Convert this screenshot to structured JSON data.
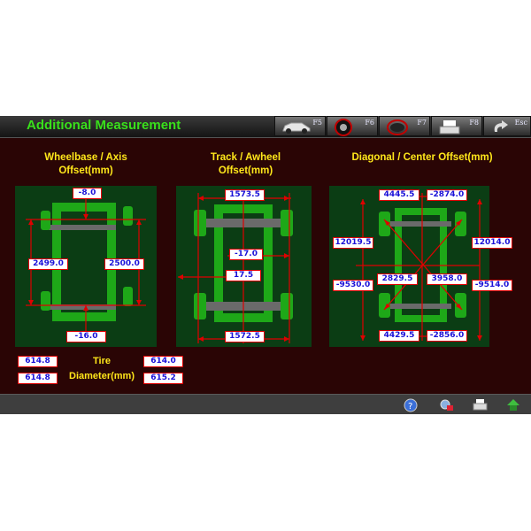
{
  "header": {
    "title": "Additional Measurement",
    "function_keys": [
      {
        "label": "F5",
        "icon": "car-icon"
      },
      {
        "label": "F6",
        "icon": "wheel-icon"
      },
      {
        "label": "F7",
        "icon": "steering-wheel-icon"
      },
      {
        "label": "F8",
        "icon": "printer-icon"
      },
      {
        "label": "Esc",
        "icon": "back-arrow-icon"
      }
    ]
  },
  "sections": {
    "wheelbase": {
      "title_line1": "Wheelbase / Axis",
      "title_line2": "Offset(mm)",
      "top_offset": "-8.0",
      "left_wheelbase": "2499.0",
      "right_wheelbase": "2500.0",
      "bottom_offset": "-16.0"
    },
    "track": {
      "title_line1": "Track / Awheel",
      "title_line2": "Offset(mm)",
      "front_track": "1573.5",
      "front_offset": "-17.0",
      "rear_offset": "17.5",
      "rear_track": "1572.5"
    },
    "diagonal": {
      "title": "Diagonal / Center Offset(mm)",
      "top_left": "4445.5",
      "top_right": "-2874.0",
      "mid_left_upper": "12019.5",
      "mid_right_upper": "12014.0",
      "mid_left_lower": "-9530.0",
      "center_left": "2829.5",
      "center_right": "3958.0",
      "mid_right_lower": "-9514.0",
      "bottom_left": "4429.5",
      "bottom_right": "-2856.0"
    },
    "tire": {
      "label_line1": "Tire",
      "label_line2": "Diameter(mm)",
      "front_left": "614.8",
      "rear_left": "614.8",
      "front_right": "614.0",
      "rear_right": "615.2"
    }
  },
  "footer": {
    "buttons": [
      "help-icon",
      "tools-icon",
      "print-icon",
      "home-icon"
    ]
  },
  "colors": {
    "background": "#2a0505",
    "panel": "#0b3d14",
    "title": "#39e01b",
    "section_title": "#ffe71a",
    "value_text": "#1a10d8",
    "value_border": "#e00000"
  }
}
